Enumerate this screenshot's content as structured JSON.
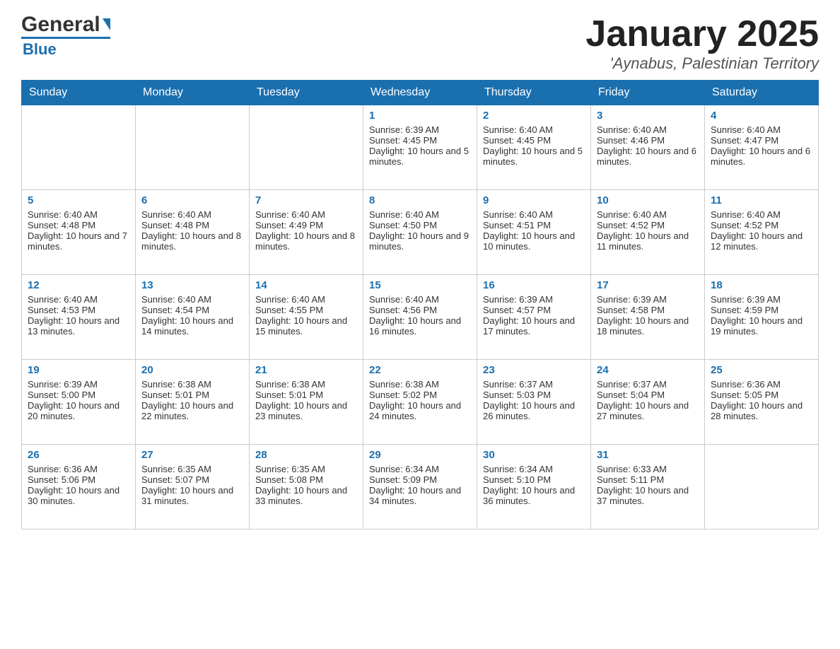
{
  "header": {
    "logo_text_dark": "General",
    "logo_text_blue": "Blue",
    "month_title": "January 2025",
    "location": "'Aynabus, Palestinian Territory"
  },
  "days_of_week": [
    "Sunday",
    "Monday",
    "Tuesday",
    "Wednesday",
    "Thursday",
    "Friday",
    "Saturday"
  ],
  "weeks": [
    [
      {
        "day": "",
        "info": ""
      },
      {
        "day": "",
        "info": ""
      },
      {
        "day": "",
        "info": ""
      },
      {
        "day": "1",
        "info": "Sunrise: 6:39 AM\nSunset: 4:45 PM\nDaylight: 10 hours and 5 minutes."
      },
      {
        "day": "2",
        "info": "Sunrise: 6:40 AM\nSunset: 4:45 PM\nDaylight: 10 hours and 5 minutes."
      },
      {
        "day": "3",
        "info": "Sunrise: 6:40 AM\nSunset: 4:46 PM\nDaylight: 10 hours and 6 minutes."
      },
      {
        "day": "4",
        "info": "Sunrise: 6:40 AM\nSunset: 4:47 PM\nDaylight: 10 hours and 6 minutes."
      }
    ],
    [
      {
        "day": "5",
        "info": "Sunrise: 6:40 AM\nSunset: 4:48 PM\nDaylight: 10 hours and 7 minutes."
      },
      {
        "day": "6",
        "info": "Sunrise: 6:40 AM\nSunset: 4:48 PM\nDaylight: 10 hours and 8 minutes."
      },
      {
        "day": "7",
        "info": "Sunrise: 6:40 AM\nSunset: 4:49 PM\nDaylight: 10 hours and 8 minutes."
      },
      {
        "day": "8",
        "info": "Sunrise: 6:40 AM\nSunset: 4:50 PM\nDaylight: 10 hours and 9 minutes."
      },
      {
        "day": "9",
        "info": "Sunrise: 6:40 AM\nSunset: 4:51 PM\nDaylight: 10 hours and 10 minutes."
      },
      {
        "day": "10",
        "info": "Sunrise: 6:40 AM\nSunset: 4:52 PM\nDaylight: 10 hours and 11 minutes."
      },
      {
        "day": "11",
        "info": "Sunrise: 6:40 AM\nSunset: 4:52 PM\nDaylight: 10 hours and 12 minutes."
      }
    ],
    [
      {
        "day": "12",
        "info": "Sunrise: 6:40 AM\nSunset: 4:53 PM\nDaylight: 10 hours and 13 minutes."
      },
      {
        "day": "13",
        "info": "Sunrise: 6:40 AM\nSunset: 4:54 PM\nDaylight: 10 hours and 14 minutes."
      },
      {
        "day": "14",
        "info": "Sunrise: 6:40 AM\nSunset: 4:55 PM\nDaylight: 10 hours and 15 minutes."
      },
      {
        "day": "15",
        "info": "Sunrise: 6:40 AM\nSunset: 4:56 PM\nDaylight: 10 hours and 16 minutes."
      },
      {
        "day": "16",
        "info": "Sunrise: 6:39 AM\nSunset: 4:57 PM\nDaylight: 10 hours and 17 minutes."
      },
      {
        "day": "17",
        "info": "Sunrise: 6:39 AM\nSunset: 4:58 PM\nDaylight: 10 hours and 18 minutes."
      },
      {
        "day": "18",
        "info": "Sunrise: 6:39 AM\nSunset: 4:59 PM\nDaylight: 10 hours and 19 minutes."
      }
    ],
    [
      {
        "day": "19",
        "info": "Sunrise: 6:39 AM\nSunset: 5:00 PM\nDaylight: 10 hours and 20 minutes."
      },
      {
        "day": "20",
        "info": "Sunrise: 6:38 AM\nSunset: 5:01 PM\nDaylight: 10 hours and 22 minutes."
      },
      {
        "day": "21",
        "info": "Sunrise: 6:38 AM\nSunset: 5:01 PM\nDaylight: 10 hours and 23 minutes."
      },
      {
        "day": "22",
        "info": "Sunrise: 6:38 AM\nSunset: 5:02 PM\nDaylight: 10 hours and 24 minutes."
      },
      {
        "day": "23",
        "info": "Sunrise: 6:37 AM\nSunset: 5:03 PM\nDaylight: 10 hours and 26 minutes."
      },
      {
        "day": "24",
        "info": "Sunrise: 6:37 AM\nSunset: 5:04 PM\nDaylight: 10 hours and 27 minutes."
      },
      {
        "day": "25",
        "info": "Sunrise: 6:36 AM\nSunset: 5:05 PM\nDaylight: 10 hours and 28 minutes."
      }
    ],
    [
      {
        "day": "26",
        "info": "Sunrise: 6:36 AM\nSunset: 5:06 PM\nDaylight: 10 hours and 30 minutes."
      },
      {
        "day": "27",
        "info": "Sunrise: 6:35 AM\nSunset: 5:07 PM\nDaylight: 10 hours and 31 minutes."
      },
      {
        "day": "28",
        "info": "Sunrise: 6:35 AM\nSunset: 5:08 PM\nDaylight: 10 hours and 33 minutes."
      },
      {
        "day": "29",
        "info": "Sunrise: 6:34 AM\nSunset: 5:09 PM\nDaylight: 10 hours and 34 minutes."
      },
      {
        "day": "30",
        "info": "Sunrise: 6:34 AM\nSunset: 5:10 PM\nDaylight: 10 hours and 36 minutes."
      },
      {
        "day": "31",
        "info": "Sunrise: 6:33 AM\nSunset: 5:11 PM\nDaylight: 10 hours and 37 minutes."
      },
      {
        "day": "",
        "info": ""
      }
    ]
  ]
}
